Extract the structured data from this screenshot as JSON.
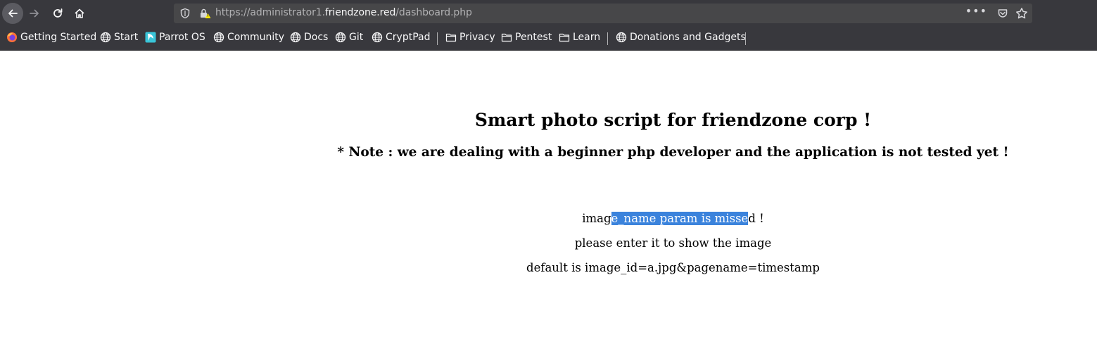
{
  "browser": {
    "url_prefix": "https://administrator1.",
    "url_host": "friendzone.red",
    "url_path": "/dashboard.php",
    "page_actions_label": "•••"
  },
  "bookmarks": [
    {
      "label": "Getting Started",
      "icon": "firefox-icon"
    },
    {
      "label": "Start",
      "icon": "globe-icon"
    },
    {
      "label": "Parrot OS",
      "icon": "parrot-icon"
    },
    {
      "label": "Community",
      "icon": "globe-icon"
    },
    {
      "label": "Docs",
      "icon": "globe-icon"
    },
    {
      "label": "Git",
      "icon": "globe-icon"
    },
    {
      "label": "CryptPad",
      "icon": "globe-icon"
    },
    {
      "label": "Privacy",
      "icon": "folder-icon"
    },
    {
      "label": "Pentest",
      "icon": "folder-icon"
    },
    {
      "label": "Learn",
      "icon": "folder-icon"
    },
    {
      "label": "Donations and Gadgets",
      "icon": "globe-icon"
    }
  ],
  "content": {
    "heading": "Smart photo script for friendzone corp !",
    "note": "* Note : we are dealing with a beginner php developer and the application is not tested yet !",
    "message_before_selection": "imag",
    "message_selected": "e_name param is misse",
    "message_after_selection": "d !",
    "instruction": "please enter it to show the image",
    "default_hint": "default is image_id=a.jpg&pagename=timestamp"
  },
  "colors": {
    "chrome_bg": "#38383d",
    "urlbar_bg": "#474749",
    "selection": "#3b83dc"
  }
}
